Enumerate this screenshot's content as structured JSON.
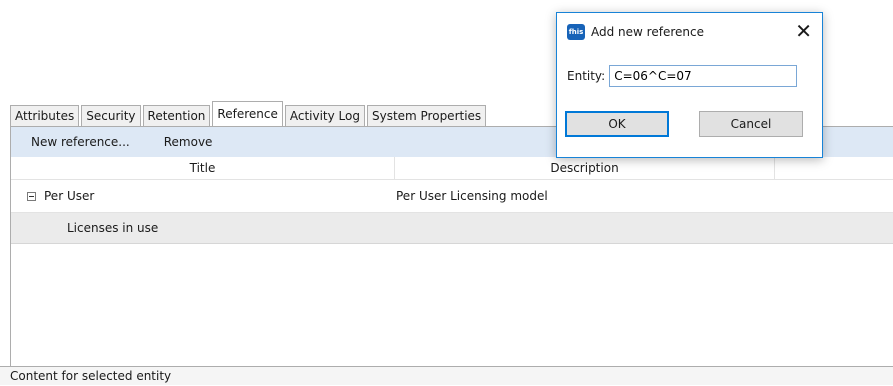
{
  "tabs": [
    "Attributes",
    "Security",
    "Retention",
    "Reference",
    "Activity Log",
    "System Properties"
  ],
  "active_tab": "Reference",
  "toolbar": {
    "new_reference": "New reference...",
    "remove": "Remove"
  },
  "grid": {
    "columns": [
      "Title",
      "Description"
    ],
    "rows": [
      {
        "title": "Per User",
        "description": "Per User Licensing model",
        "expanded": true
      },
      {
        "title": "Licenses in use",
        "description": ""
      }
    ]
  },
  "status_bar": "Content for selected entity",
  "dialog": {
    "title": "Add new reference",
    "logo_text": "fhis",
    "close_glyph": "✕",
    "entity_label": "Entity:",
    "entity_value": "C=06^C=07",
    "ok": "OK",
    "cancel": "Cancel"
  }
}
